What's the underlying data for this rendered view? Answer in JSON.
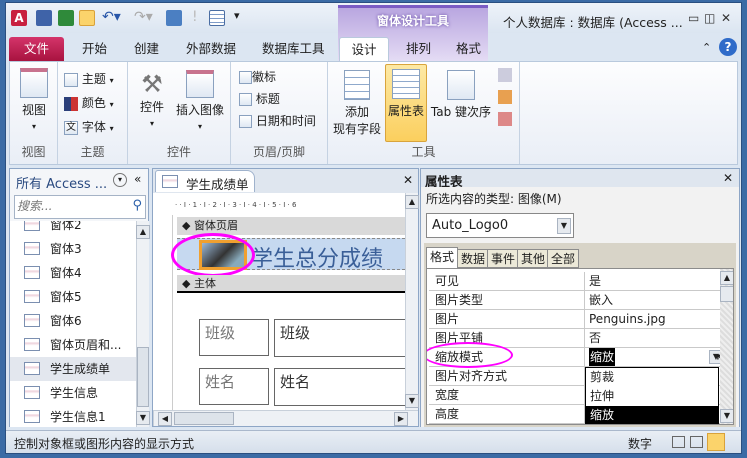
{
  "window": {
    "title": "个人数据库 : 数据库 (Access ...",
    "context_tab": "窗体设计工具"
  },
  "tabs": [
    "文件",
    "开始",
    "创建",
    "外部数据",
    "数据库工具",
    "设计",
    "排列",
    "格式"
  ],
  "ribbon": {
    "groups": [
      "视图",
      "主题",
      "控件",
      "页眉/页脚",
      "工具"
    ],
    "view": "视图",
    "theme": "主题",
    "color": "颜色",
    "font": "字体",
    "control": "控件",
    "insert_image": "插入图像",
    "logo": "徽标",
    "title": "标题",
    "datetime": "日期和时间",
    "add_field_1": "添加",
    "add_field_2": "现有字段",
    "property_sheet": "属性表",
    "tab_order": "Tab 键次序"
  },
  "nav": {
    "header": "所有 Access ...",
    "search_placeholder": "搜索...",
    "items": [
      "窗体2",
      "窗体3",
      "窗体4",
      "窗体5",
      "窗体6",
      "窗体页眉和...",
      "学生成绩单",
      "学生信息",
      "学生信息1"
    ],
    "selected": 6
  },
  "doc": {
    "tab": "学生成绩单",
    "ruler": "· · I · 1 · I · 2 · I · 3 · I · 4 · I · 5 · I · 6",
    "header_band": "窗体页眉",
    "form_title": "学生总分成绩",
    "body_band": "主体",
    "fields": [
      {
        "label": "班级",
        "value": "班级"
      },
      {
        "label": "姓名",
        "value": "姓名"
      }
    ]
  },
  "props": {
    "title": "属性表",
    "selection_type": "所选内容的类型:  图像(M)",
    "object": "Auto_Logo0",
    "tabs": [
      "格式",
      "数据",
      "事件",
      "其他",
      "全部"
    ],
    "rows": [
      {
        "k": "可见",
        "v": "是"
      },
      {
        "k": "图片类型",
        "v": "嵌入"
      },
      {
        "k": "图片",
        "v": "Penguins.jpg"
      },
      {
        "k": "图片平铺",
        "v": "否"
      },
      {
        "k": "缩放模式",
        "v": "缩放"
      },
      {
        "k": "图片对齐方式",
        "v": ""
      },
      {
        "k": "宽度",
        "v": ""
      },
      {
        "k": "高度",
        "v": ""
      }
    ],
    "dropdown": [
      "剪裁",
      "拉伸",
      "缩放"
    ]
  },
  "status": {
    "text": "控制对象框或图形内容的显示方式",
    "mode": "数字"
  },
  "colors": {
    "accent_file": "#b5194f",
    "highlight": "#ff00ff",
    "selected": "#000000"
  }
}
